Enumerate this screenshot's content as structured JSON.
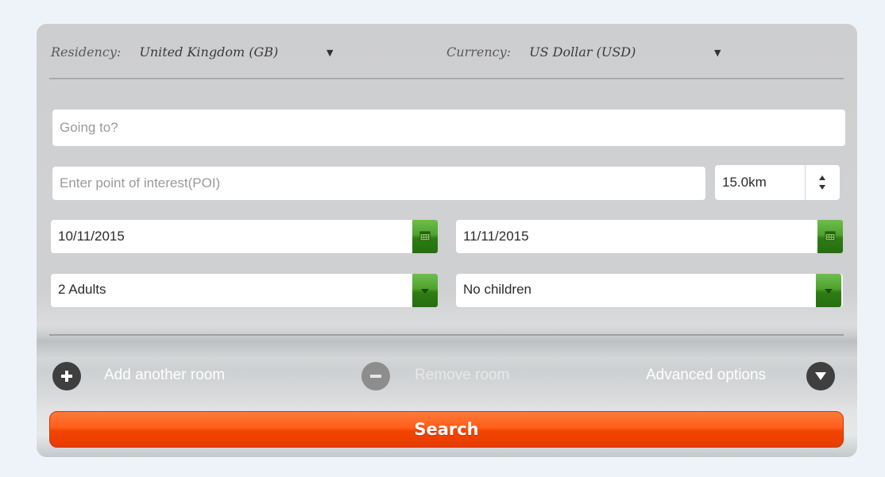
{
  "settings": {
    "residency_label": "Residency:",
    "residency_value": "United Kingdom (GB)",
    "currency_label": "Currency:",
    "currency_value": "US Dollar (USD)"
  },
  "search_form": {
    "destination_placeholder": "Going to?",
    "poi_placeholder": "Enter point of interest(POI)",
    "radius_value": "15.0km",
    "checkin_date": "10/11/2015",
    "checkout_date": "11/11/2015",
    "adults_value": "2 Adults",
    "children_value": "No children"
  },
  "room_controls": {
    "add_room_label": "Add another room",
    "remove_room_label": "Remove room",
    "advanced_label": "Advanced options"
  },
  "search_button_label": "Search",
  "icons": {
    "calendar": "calendar-icon",
    "dropdown": "chevron-down-icon",
    "add": "plus-circle-icon",
    "remove": "minus-circle-icon",
    "advanced": "chevron-down-circle-icon"
  },
  "colors": {
    "accent_green": "#4fa12e",
    "search_orange": "#ff5e1a",
    "panel_gray": "#cfd0d1"
  }
}
